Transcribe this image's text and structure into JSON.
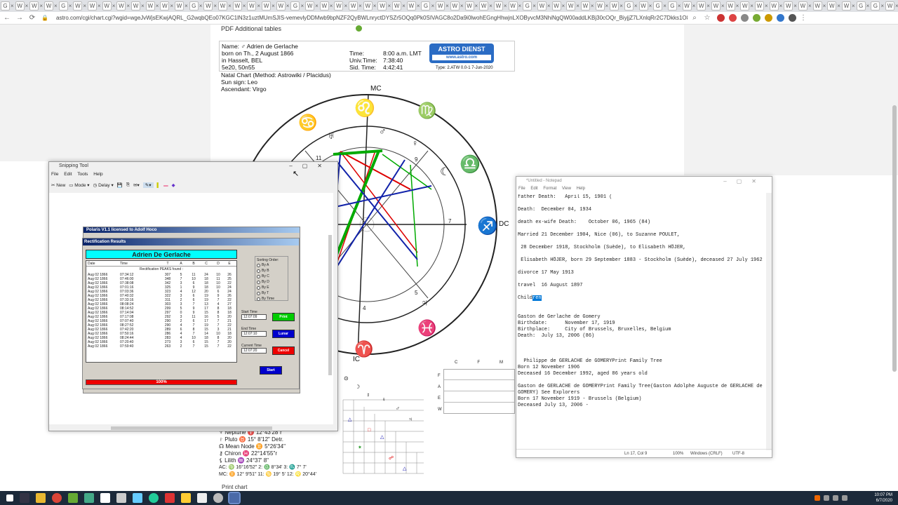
{
  "browser": {
    "tab_icons": [
      "G",
      "W",
      "W",
      "W",
      "G",
      "W",
      "W",
      "W",
      "W",
      "W",
      "W",
      "W",
      "W",
      "G",
      "W",
      "W",
      "W",
      "W",
      "W",
      "W",
      "G",
      "W",
      "W",
      "W",
      "W",
      "W",
      "W",
      "W",
      "W",
      "G",
      "W",
      "W",
      "W",
      "W",
      "W",
      "W",
      "G",
      "W",
      "W",
      "W",
      "W",
      "W",
      "W",
      "G",
      "W",
      "G",
      "G",
      "W",
      "W",
      "W",
      "W",
      "W",
      "W",
      "W",
      "W",
      "W",
      "W",
      "W",
      "W",
      "G",
      "G",
      "W",
      "W",
      "W",
      "W",
      "W",
      "W",
      "W",
      "W",
      "W",
      "W"
    ],
    "url": "astro.com/cgi/chart.cgi?wgid=wgeJvWjsEKwjAQRL_G2wqbQEo07KGC1lN3z1uztMUmSJIS-vemevlyDDMwb9bpNZF2QyBWLnryctDYSZr5OQq0Pk0SIVAGC8o2Da9i0lwohEGngHhwjnLXOByvcM3NhiNgQW00addLKBj30cOQr_BiyjjZ7LXnlqRr2C7Dkks1O8_1ZXvXf6GMxGV1Y97oqFzKpB7dB56_OLU"
  },
  "page": {
    "pdf_link": "PDF Additional tables",
    "name_label": "Name:  ♂  Adrien de Gerlache",
    "born": "born on Th., 2 August 1866",
    "place": "in Hasselt, BEL",
    "coords": "5e20, 50n55",
    "time_lbl": "Time:",
    "time_val": "8:00 a.m. LMT",
    "univ_lbl": "Univ.Time:",
    "univ_val": "7:38:40",
    "sid_lbl": "Sid. Time:",
    "sid_val": "4:42:41",
    "logo_text": "ASTRO DIENST",
    "logo_sub": "www.astro.com",
    "type_text": "Type: 2.ATW  0.0-1  7-Jun-2020",
    "natal": "Natal Chart  (Method: Astrowiki / Placidus)",
    "sun": "Sun sign: Leo",
    "asc": "Ascendant: Virgo",
    "mc": "MC",
    "dc": "DC",
    "ic": "IC",
    "print_chart": "Print chart",
    "planets": [
      "♆ Neptune    ♈ 12°43'28\"r",
      "♇ Pluto       ♉ 15°  8'12\"   Detr.",
      "☊ Mean Node   ♊  5°26'34\"",
      "⚷ Chiron      ♓ 22°14'55\"r",
      "⚸ Lilith      ♒ 24°37'  8\"",
      "AC: ♍ 16°16'52\"   2: ♎  8°34'   3: ♏  7°  7'",
      "MC: ♊ 12°  9'51\"  11: ♋ 19°  5'  12: ♌ 20°44'"
    ],
    "ptable_cols": [
      "C",
      "F",
      "M"
    ],
    "ptable_rows": [
      "F",
      "A",
      "E",
      "W"
    ]
  },
  "snip": {
    "title": "Snipping Tool",
    "menu": [
      "File",
      "Edit",
      "Tools",
      "Help"
    ],
    "new": "New",
    "mode": "Mode",
    "delay": "Delay"
  },
  "polaris": {
    "title": "Polaris V1.1 licensed to Adolf Hoco",
    "rect_title": "Rectification Results",
    "name": "Adrien De Gerlache",
    "headers": [
      "Date",
      "Time",
      "T",
      "A",
      "B",
      "C",
      "D",
      "E"
    ],
    "peaks_label": "Rectification PEAKS found :",
    "rows": [
      [
        "Aug 02 1866",
        "07:34:12",
        "307",
        "5",
        "11",
        "24",
        "10",
        "26"
      ],
      [
        "Aug 02 1866",
        "07:46:00",
        "348",
        "7",
        "10",
        "18",
        "11",
        "25"
      ],
      [
        "Aug 02 1866",
        "07:38:08",
        "342",
        "3",
        "6",
        "18",
        "10",
        "22"
      ],
      [
        "Aug 02 1866",
        "07:01:16",
        "325",
        "1",
        "9",
        "18",
        "10",
        "24"
      ],
      [
        "Aug 02 1866",
        "07:03:36",
        "323",
        "4",
        "12",
        "20",
        "6",
        "24"
      ],
      [
        "Aug 02 1866",
        "07:40:32",
        "322",
        "3",
        "6",
        "19",
        "9",
        "26"
      ],
      [
        "Aug 02 1866",
        "07:33:16",
        "311",
        "2",
        "6",
        "19",
        "7",
        "22"
      ],
      [
        "Aug 02 1866",
        "08:08:24",
        "303",
        "3",
        "7",
        "13",
        "4",
        "27"
      ],
      [
        "Aug 02 1866",
        "08:14:52",
        "299",
        "5",
        "9",
        "17",
        "8",
        "18"
      ],
      [
        "Aug 02 1866",
        "07:14:04",
        "297",
        "0",
        "9",
        "15",
        "8",
        "18"
      ],
      [
        "Aug 02 1866",
        "07:17:08",
        "292",
        "3",
        "11",
        "16",
        "5",
        "20"
      ],
      [
        "Aug 02 1866",
        "07:07:40",
        "290",
        "2",
        "6",
        "17",
        "7",
        "21"
      ],
      [
        "Aug 02 1866",
        "08:27:52",
        "290",
        "4",
        "7",
        "19",
        "7",
        "22"
      ],
      [
        "Aug 02 1866",
        "07:42:20",
        "289",
        "6",
        "8",
        "15",
        "3",
        "21"
      ],
      [
        "Aug 02 1866",
        "07:50:16",
        "286",
        "4",
        "7",
        "14",
        "10",
        "18"
      ],
      [
        "Aug 02 1866",
        "08:24:44",
        "283",
        "4",
        "10",
        "18",
        "8",
        "20"
      ],
      [
        "Aug 02 1866",
        "07:20:40",
        "273",
        "3",
        "6",
        "15",
        "7",
        "20"
      ],
      [
        "Aug 02 1866",
        "07:59:40",
        "263",
        "2",
        "7",
        "15",
        "7",
        "22"
      ]
    ],
    "sort_title": "Sorting Order:",
    "sort_options": [
      "By A",
      "By B",
      "By C",
      "By D",
      "By E",
      "By T",
      "By Time"
    ],
    "start_time_lbl": "Start Time",
    "start_time": "12:07:09",
    "end_time_lbl": "End Time",
    "end_time": "12:07:10",
    "cur_time_lbl": "Current Time",
    "cur_time": "12:07:20",
    "btn_print": "Print",
    "btn_lunar": "Lunar",
    "btn_cancel": "Cancel",
    "btn_start": "Start",
    "progress": "100%",
    "progress_fraction": 1.0
  },
  "notepad": {
    "title": "*Untitled - Notepad",
    "menu": [
      "File",
      "Edit",
      "Format",
      "View",
      "Help"
    ],
    "lines": [
      "father Death:   April 15, 1901 (",
      "",
      "Death:  December 04, 1934",
      "",
      "death ex-wife Death:    October 06, 1965 (84)",
      "",
      "Married 21 December 1904, Nice (06), to Suzanne POULET,",
      "",
      " 28 December 1918, Stockholm (Suède), to Elisabeth HÖJER,",
      "",
      " Elisabeth HÖJER, born 29 September 1883 - Stockholm (Suède), deceased 27 July 1962",
      "",
      "divorce 17 May 1913",
      "",
      "travel  16 August 1897",
      "",
      "Child",
      "",
      "",
      "Gaston de Gerlache de Gomery",
      "Birthdate:      November 17, 1919",
      "Birthplace:     City of Brussels, Bruxelles, Belgium",
      "Death:  July 13, 2006 (86)",
      "",
      "",
      "",
      "  Philippe de GERLACHE de GOMERYPrint Family Tree",
      "Born 12 November 1906",
      "Deceased 16 December 1992, aged 86 years old",
      "",
      "Gaston de GERLACHE de GOMERYPrint Family Tree(Gaston Adolphe Auguste de GERLACHE de",
      "GOMERY) See Explorers",
      "Born 17 November 1919 - Brussels (Belgium)",
      "Deceased July 13, 2006 -"
    ],
    "selected_text": "ren",
    "status_pos": "Ln 17, Col 9",
    "status_zoom": "100%",
    "status_eol": "Windows (CRLF)",
    "status_enc": "UTF-8"
  },
  "taskbar": {
    "time": "10:07 PM",
    "date": "6/7/2020"
  }
}
